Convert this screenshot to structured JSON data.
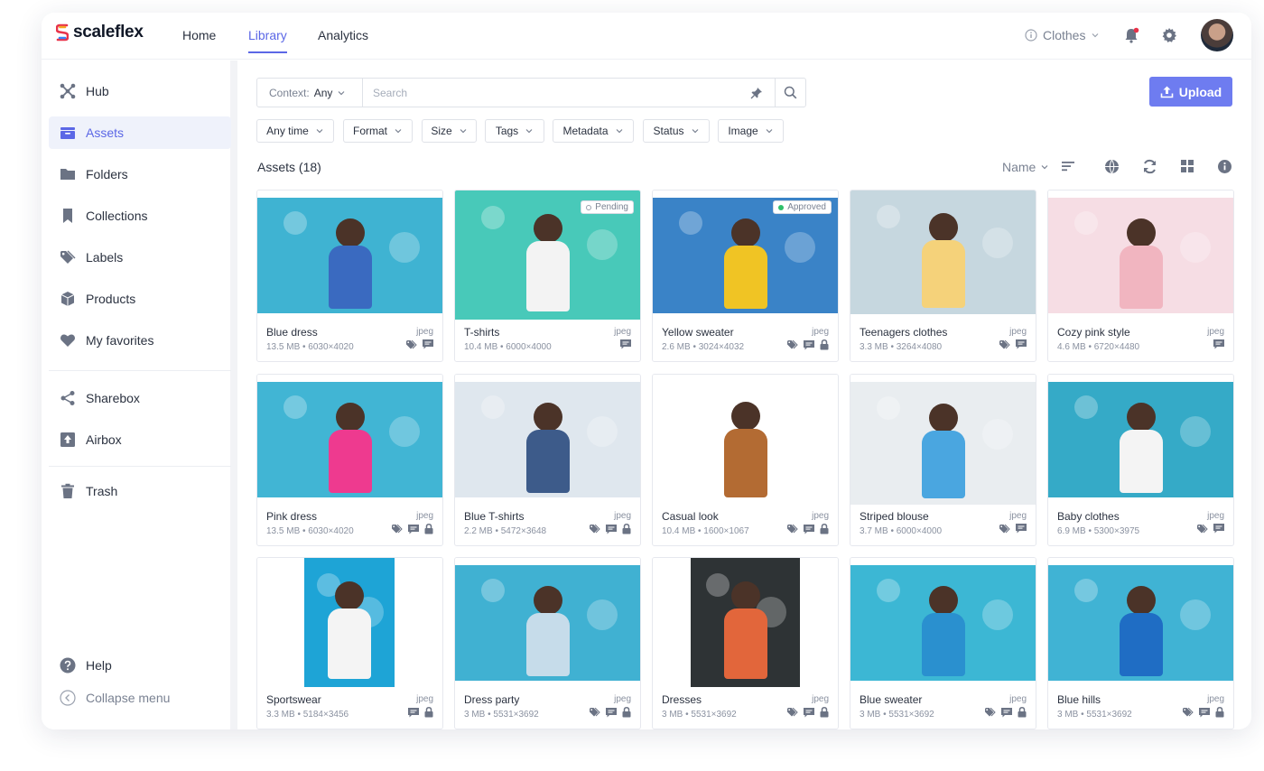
{
  "app": {
    "brand": "scaleflex"
  },
  "nav": {
    "items": [
      {
        "label": "Home"
      },
      {
        "label": "Library"
      },
      {
        "label": "Analytics"
      }
    ],
    "context_label": "Clothes"
  },
  "sidebar": {
    "items": [
      {
        "label": "Hub",
        "icon": "hub-icon"
      },
      {
        "label": "Assets",
        "icon": "assets-icon"
      },
      {
        "label": "Folders",
        "icon": "folder-icon"
      },
      {
        "label": "Collections",
        "icon": "bookmark-icon"
      },
      {
        "label": "Labels",
        "icon": "tag-icon"
      },
      {
        "label": "Products",
        "icon": "box-icon"
      },
      {
        "label": "My favorites",
        "icon": "heart-icon"
      },
      {
        "label": "Sharebox",
        "icon": "share-icon"
      },
      {
        "label": "Airbox",
        "icon": "upload-box-icon"
      },
      {
        "label": "Trash",
        "icon": "trash-icon"
      }
    ],
    "help_label": "Help",
    "collapse_label": "Collapse menu"
  },
  "search": {
    "context_prefix": "Context:",
    "context_value": "Any",
    "placeholder": "Search"
  },
  "upload_label": "Upload",
  "filters": [
    "Any time",
    "Format",
    "Size",
    "Tags",
    "Metadata",
    "Status",
    "Image"
  ],
  "assets_title": "Assets (18)",
  "sort_label": "Name",
  "colors": {
    "accent": "#5b67e6",
    "upload": "#6e7cf0",
    "photo_blue": "#3fb3d2",
    "approved": "#2fbf6a"
  },
  "assets": [
    {
      "name": "Blue dress",
      "ext": "jpeg",
      "meta": "13.5 MB • 6030×4020",
      "badge": ""
    },
    {
      "name": "T-shirts",
      "ext": "jpeg",
      "meta": "10.4  MB • 6000×4000",
      "badge": "Pending"
    },
    {
      "name": "Yellow sweater",
      "ext": "jpeg",
      "meta": "2.6 MB • 3024×4032",
      "badge": "Approved"
    },
    {
      "name": "Teenagers clothes",
      "ext": "jpeg",
      "meta": "3.3 MB • 3264×4080",
      "badge": ""
    },
    {
      "name": "Cozy pink style",
      "ext": "jpeg",
      "meta": "4.6 MB • 6720×4480",
      "badge": ""
    },
    {
      "name": "Pink dress",
      "ext": "jpeg",
      "meta": "13.5 MB • 6030×4020",
      "badge": ""
    },
    {
      "name": "Blue T-shirts",
      "ext": "jpeg",
      "meta": "2.2 MB • 5472×3648",
      "badge": ""
    },
    {
      "name": "Casual look",
      "ext": "jpeg",
      "meta": "10.4 MB • 1600×1067",
      "badge": ""
    },
    {
      "name": "Striped blouse",
      "ext": "jpeg",
      "meta": "3.7 MB • 6000×4000",
      "badge": ""
    },
    {
      "name": "Baby clothes",
      "ext": "jpeg",
      "meta": "6.9 MB • 5300×3975",
      "badge": ""
    },
    {
      "name": "Sportswear",
      "ext": "jpeg",
      "meta": "3.3 MB • 5184×3456",
      "badge": ""
    },
    {
      "name": "Dress party",
      "ext": "jpeg",
      "meta": "3 MB • 5531×3692",
      "badge": ""
    },
    {
      "name": "Dresses",
      "ext": "jpeg",
      "meta": "3 MB • 5531×3692",
      "badge": ""
    },
    {
      "name": "Blue sweater",
      "ext": "jpeg",
      "meta": "3 MB • 5531×3692",
      "badge": ""
    },
    {
      "name": "Blue hills",
      "ext": "jpeg",
      "meta": "3 MB • 5531×3692",
      "badge": ""
    }
  ]
}
